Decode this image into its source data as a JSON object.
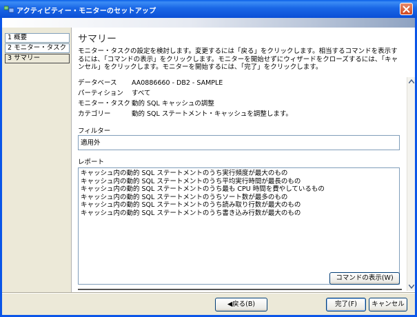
{
  "window": {
    "title": "アクティビティー・モニターのセットアップ"
  },
  "nav": {
    "items": [
      {
        "label": "1 概要"
      },
      {
        "label": "2 モニター・タスク"
      },
      {
        "label": "3 サマリー"
      }
    ]
  },
  "content": {
    "title": "サマリー",
    "intro": "モニター・タスクの設定を検討します。変更するには「戻る」をクリックします。相当するコマンドを表示するには、「コマンドの表示」をクリックします。モニターを開始せずにウィザードをクローズするには、「キャンセル」をクリックします。モニターを開始するには、「完了」をクリックします。",
    "properties": [
      {
        "label": "データベース",
        "value": "AA0886660 - DB2 - SAMPLE"
      },
      {
        "label": "パーティション",
        "value": "すべて"
      },
      {
        "label": "モニター・タスク",
        "value": "動的 SQL キャッシュの調整"
      },
      {
        "label": "カテゴリー",
        "value": "動的 SQL ステートメント・キャッシュを調整します。"
      }
    ],
    "filter_label": "フィルター",
    "filter_value": "適用外",
    "report_label": "レポート",
    "report_items": [
      "キャッシュ内の動的 SQL ステートメントのうち実行頻度が最大のもの",
      "キャッシュ内の動的 SQL ステートメントのうち平均実行時間が最長のもの",
      "キャッシュ内の動的 SQL ステートメントのうち最も CPU 時間を費やしているもの",
      "キャッシュ内の動的 SQL ステートメントのうちソート数が最多のもの",
      "キャッシュ内の動的 SQL ステートメントのうち読み取り行数が最大のもの",
      "キャッシュ内の動的 SQL ステートメントのうち書き込み行数が最大のもの"
    ],
    "show_command_label": "コマンドの表示(W)"
  },
  "footer": {
    "back_label": "◀戻る(B)",
    "finish_label": "完了(F)",
    "cancel_label": "キャンセル"
  },
  "colors": {
    "title_bar": "#0a55e8",
    "face": "#ece9d8",
    "close": "#d1491f"
  }
}
